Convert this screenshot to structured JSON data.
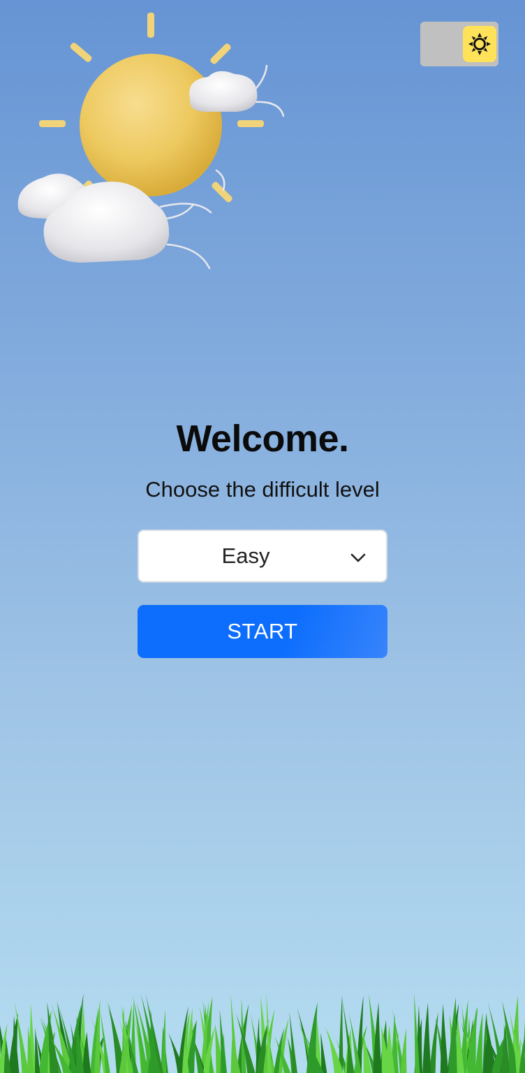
{
  "welcome": {
    "title": "Welcome.",
    "subtitle": "Choose the difficult level"
  },
  "difficulty_select": {
    "value": "Easy",
    "icon": "chevron-down-icon"
  },
  "start_button": {
    "label": "START",
    "color": "#0d6efd"
  },
  "theme_toggle": {
    "icon": "sun-icon",
    "knob_color": "#fde25a",
    "track_color": "#c0c0c0"
  },
  "illustration": {
    "name": "sun-behind-clouds-icon"
  },
  "colors": {
    "sky_top": "#6694d4",
    "sky_bottom": "#b4dcf0",
    "grass": "#3aa02a"
  }
}
